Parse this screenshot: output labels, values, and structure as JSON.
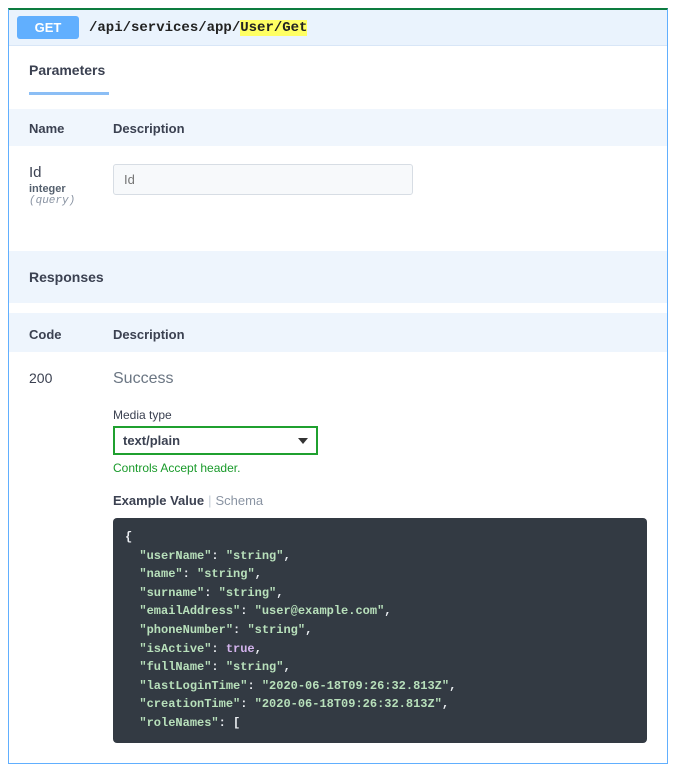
{
  "operation": {
    "method": "GET",
    "path_prefix": "/api/services/app/",
    "path_highlight": "User/Get"
  },
  "tabs": {
    "parameters": "Parameters"
  },
  "param_headers": {
    "name": "Name",
    "description": "Description"
  },
  "parameter": {
    "name": "Id",
    "type": "integer",
    "location": "(query)",
    "placeholder": "Id"
  },
  "responses": {
    "title": "Responses",
    "code_header": "Code",
    "desc_header": "Description",
    "code": "200",
    "status_text": "Success",
    "media_type_label": "Media type",
    "media_type_value": "text/plain",
    "accept_note": "Controls Accept header.",
    "example_value_label": "Example Value",
    "schema_label": "Schema"
  },
  "example": {
    "userName": "string",
    "name": "string",
    "surname": "string",
    "emailAddress": "user@example.com",
    "phoneNumber": "string",
    "isActive": "true",
    "fullName": "string",
    "lastLoginTime": "2020-06-18T09:26:32.813Z",
    "creationTime": "2020-06-18T09:26:32.813Z",
    "roleNames_open": "["
  }
}
